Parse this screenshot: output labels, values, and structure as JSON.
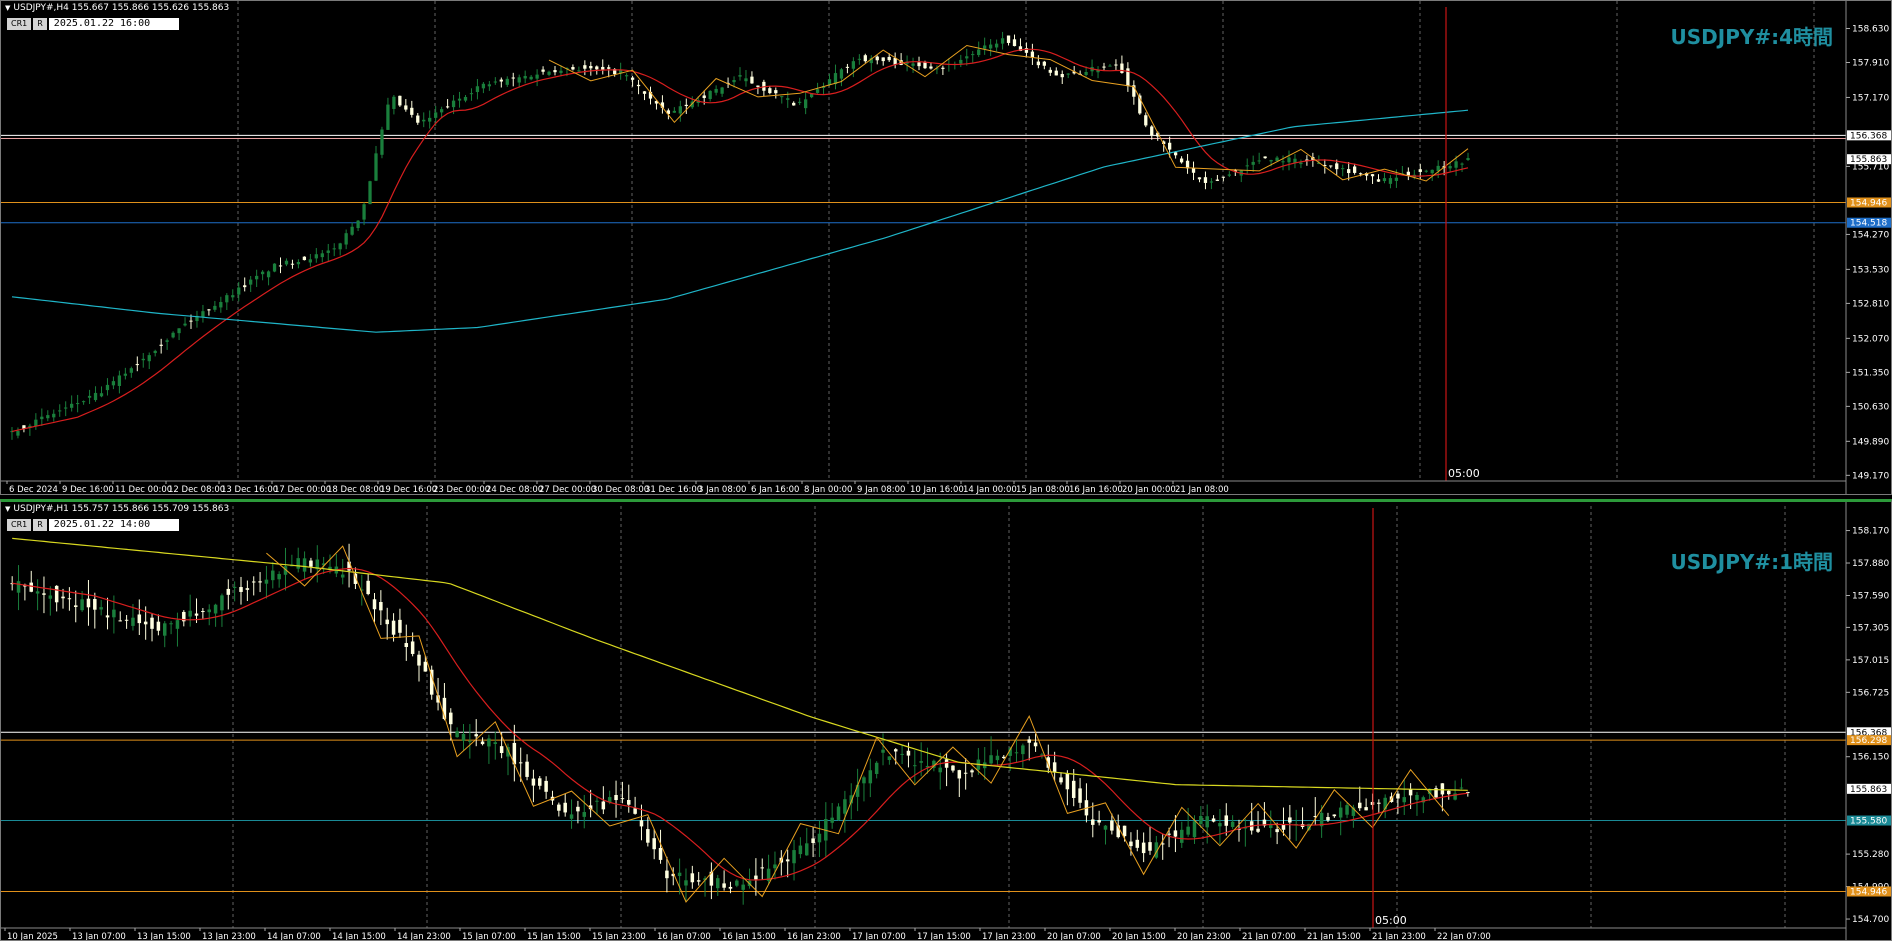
{
  "colors": {
    "background": "#000000",
    "bull": "#1a7f3c",
    "bear": "#ffffe0",
    "ma_fast": "#d81e1e",
    "ma_slow_h4": "#1fb5c8",
    "ma_slow_h1": "#d8d820",
    "zigzag": "#e8a020",
    "title": "#1f8fa0",
    "vline": "#c81414",
    "level_orange": "#e0901a",
    "level_blue": "#1e6ec8",
    "level_white": "#ffffff"
  },
  "h4": {
    "header": "USDJPY#,H4  155.667 155.866 155.626 155.863",
    "btn_cr": "CR1",
    "btn_r": "R",
    "datetime": "2025.01.22 16:00",
    "title": "USDJPY#:4時間",
    "time_marker": "05:00",
    "scale": [
      158.63,
      157.91,
      157.17,
      156.368,
      155.863,
      155.71,
      154.946,
      154.518,
      154.27,
      153.53,
      152.81,
      152.07,
      151.35,
      150.63,
      149.89,
      149.17
    ],
    "price_labels": [
      {
        "price": 158.63,
        "text": "158.630",
        "kind": "tick"
      },
      {
        "price": 157.91,
        "text": "157.910",
        "kind": "tick"
      },
      {
        "price": 157.17,
        "text": "157.170",
        "kind": "tick"
      },
      {
        "price": 156.368,
        "text": "156.368",
        "kind": "white"
      },
      {
        "price": 155.863,
        "text": "155.863",
        "kind": "white"
      },
      {
        "price": 155.71,
        "text": "155.710",
        "kind": "tick"
      },
      {
        "price": 154.946,
        "text": "154.946",
        "kind": "orange"
      },
      {
        "price": 154.518,
        "text": "154.518",
        "kind": "blue"
      },
      {
        "price": 154.27,
        "text": "154.270",
        "kind": "tick"
      },
      {
        "price": 153.53,
        "text": "153.530",
        "kind": "tick"
      },
      {
        "price": 152.81,
        "text": "152.810",
        "kind": "tick"
      },
      {
        "price": 152.07,
        "text": "152.070",
        "kind": "tick"
      },
      {
        "price": 151.35,
        "text": "151.350",
        "kind": "tick"
      },
      {
        "price": 150.63,
        "text": "150.630",
        "kind": "tick"
      },
      {
        "price": 149.89,
        "text": "149.890",
        "kind": "tick"
      },
      {
        "price": 149.17,
        "text": "149.170",
        "kind": "tick"
      }
    ],
    "time_labels": [
      "6 Dec 2024",
      "9 Dec 16:00",
      "11 Dec 00:00",
      "12 Dec 08:00",
      "13 Dec 16:00",
      "17 Dec 00:00",
      "18 Dec 08:00",
      "19 Dec 16:00",
      "23 Dec 00:00",
      "24 Dec 08:00",
      "27 Dec 00:00",
      "30 Dec 08:00",
      "31 Dec 16:00",
      "3 Jan 08:00",
      "6 Jan 16:00",
      "8 Jan 00:00",
      "9 Jan 08:00",
      "10 Jan 16:00",
      "14 Jan 00:00",
      "15 Jan 08:00",
      "16 Jan 16:00",
      "20 Jan 00:00",
      "21 Jan 08:00"
    ],
    "levels": [
      {
        "price": 156.368,
        "kind": "white"
      },
      {
        "price": 156.3,
        "kind": "pink"
      },
      {
        "price": 154.946,
        "kind": "orange"
      },
      {
        "price": 154.518,
        "kind": "blue"
      }
    ]
  },
  "h1": {
    "header": "USDJPY#,H1  155.757 155.866 155.709 155.863",
    "btn_cr": "CR1",
    "btn_r": "R",
    "datetime": "2025.01.22 14:00",
    "title": "USDJPY#:1時間",
    "time_marker": "05:00",
    "price_labels": [
      {
        "price": 158.17,
        "text": "158.170",
        "kind": "tick"
      },
      {
        "price": 157.88,
        "text": "157.880",
        "kind": "tick"
      },
      {
        "price": 157.59,
        "text": "157.590",
        "kind": "tick"
      },
      {
        "price": 157.305,
        "text": "157.305",
        "kind": "tick"
      },
      {
        "price": 157.015,
        "text": "157.015",
        "kind": "tick"
      },
      {
        "price": 156.725,
        "text": "156.725",
        "kind": "tick"
      },
      {
        "price": 156.368,
        "text": "156.368",
        "kind": "white"
      },
      {
        "price": 156.298,
        "text": "156.298",
        "kind": "orange"
      },
      {
        "price": 156.15,
        "text": "156.150",
        "kind": "tick"
      },
      {
        "price": 155.863,
        "text": "155.863",
        "kind": "white"
      },
      {
        "price": 155.58,
        "text": "155.580",
        "kind": "teal"
      },
      {
        "price": 155.28,
        "text": "155.280",
        "kind": "tick"
      },
      {
        "price": 154.99,
        "text": "154.990",
        "kind": "tick"
      },
      {
        "price": 154.946,
        "text": "154.946",
        "kind": "orange"
      },
      {
        "price": 154.7,
        "text": "154.700",
        "kind": "tick"
      }
    ],
    "time_labels": [
      "10 Jan 2025",
      "13 Jan 07:00",
      "13 Jan 15:00",
      "13 Jan 23:00",
      "14 Jan 07:00",
      "14 Jan 15:00",
      "14 Jan 23:00",
      "15 Jan 07:00",
      "15 Jan 15:00",
      "15 Jan 23:00",
      "16 Jan 07:00",
      "16 Jan 15:00",
      "16 Jan 23:00",
      "17 Jan 07:00",
      "17 Jan 15:00",
      "17 Jan 23:00",
      "20 Jan 07:00",
      "20 Jan 15:00",
      "20 Jan 23:00",
      "21 Jan 07:00",
      "21 Jan 15:00",
      "21 Jan 23:00",
      "22 Jan 07:00"
    ],
    "levels": [
      {
        "price": 156.368,
        "kind": "white"
      },
      {
        "price": 156.298,
        "kind": "orange"
      },
      {
        "price": 155.58,
        "kind": "teal"
      },
      {
        "price": 154.946,
        "kind": "orange"
      }
    ]
  }
}
